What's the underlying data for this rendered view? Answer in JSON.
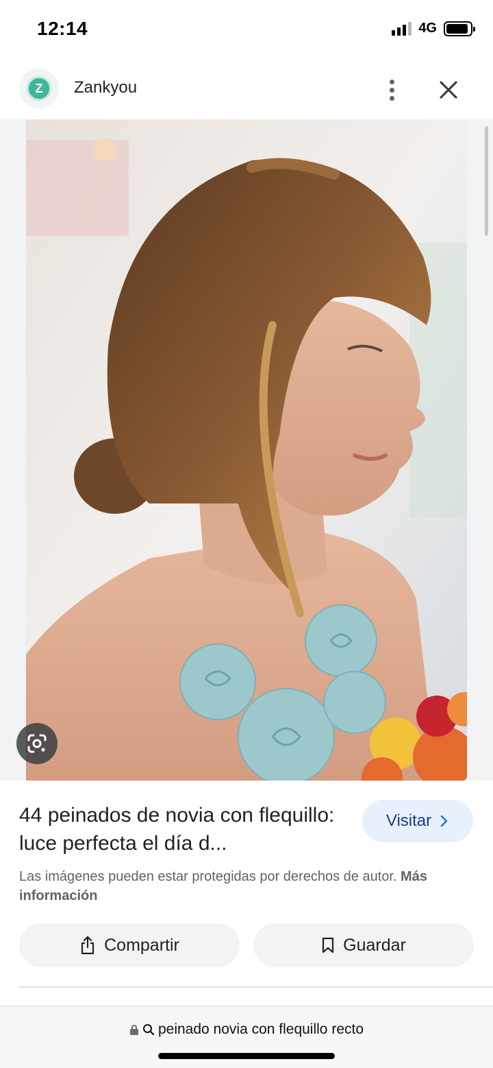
{
  "status_bar": {
    "time": "12:14",
    "network": "4G",
    "battery_level": 0.9
  },
  "header": {
    "logo_letter": "Z",
    "site_name": "Zankyou",
    "menu_icon": "more-vert-icon",
    "close_icon": "close-icon"
  },
  "image": {
    "lens_icon": "google-lens-icon"
  },
  "result": {
    "title": "44 peinados de novia con flequillo: luce perfecta el día d...",
    "visit_label": "Visitar",
    "copyright_text": "Las imágenes pueden estar protegidas por derechos de autor.",
    "more_info_label": "Más información"
  },
  "actions": {
    "share_label": "Compartir",
    "save_label": "Guardar",
    "share_icon": "share-icon",
    "save_icon": "bookmark-icon"
  },
  "browser": {
    "url_text": "peinado novia con flequillo recto",
    "lock_icon": "lock-icon",
    "search_icon": "search-icon"
  },
  "colors": {
    "accent": "#1a73e8",
    "visit_bg": "#e8f0fe",
    "chip_bg": "#f1f3f4"
  }
}
